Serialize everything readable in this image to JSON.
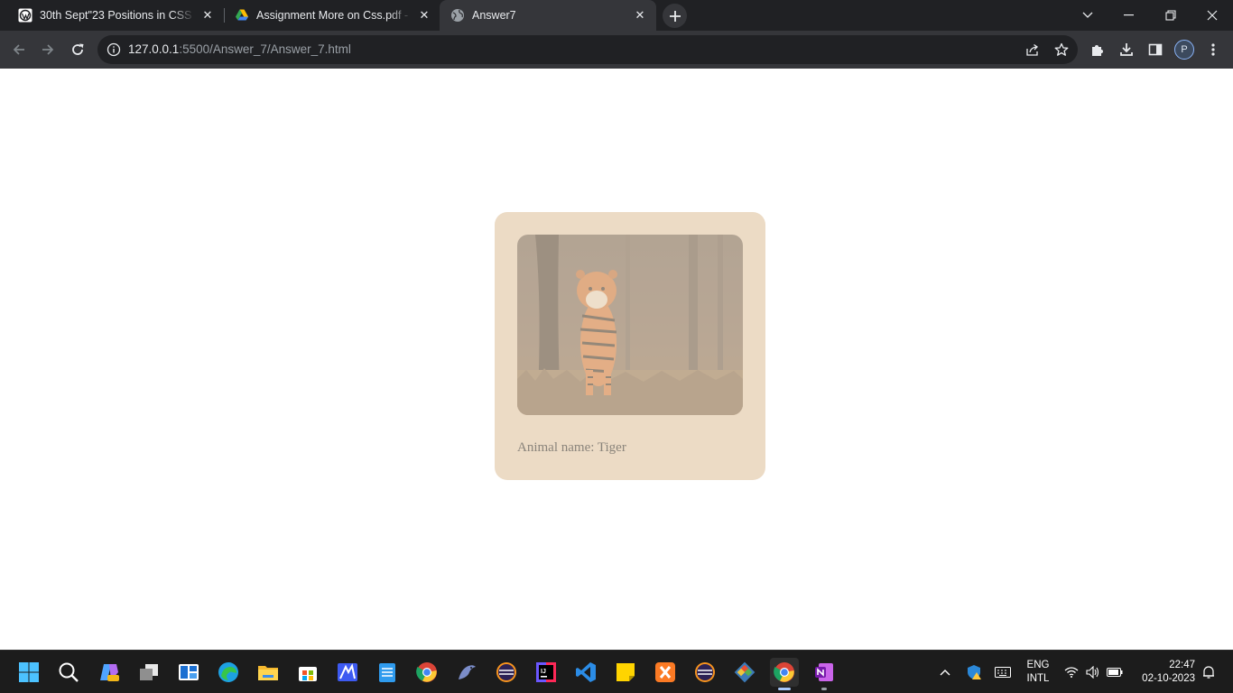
{
  "browser": {
    "tabs": [
      {
        "title": "30th Sept\"23 Positions in CSS - P",
        "icon": "wordpress-like-icon"
      },
      {
        "title": "Assignment More on Css.pdf - G",
        "icon": "google-drive-icon"
      },
      {
        "title": "Answer7",
        "icon": "globe-icon"
      }
    ],
    "url_host": "127.0.0.1",
    "url_path": ":5500/Answer_7/Answer_7.html",
    "profile_initial": "P"
  },
  "page": {
    "card_background": "#ecdbc5",
    "image_subject": "Tiger",
    "caption": "Animal name: Tiger"
  },
  "taskbar": {
    "apps": [
      "start-icon",
      "search-icon",
      "copilot-icon",
      "task-view-icon",
      "widgets-icon",
      "edge-icon",
      "file-explorer-icon",
      "store-icon",
      "power-automate-icon",
      "notepad-icon",
      "chrome-icon",
      "mysql-workbench-icon",
      "eclipse-icon",
      "intellij-icon",
      "vscode-icon",
      "sticky-notes-icon",
      "xampp-icon",
      "eclipse-alt-icon",
      "git-icon",
      "chrome-active-icon",
      "onenote-icon"
    ],
    "language": "ENG",
    "layout": "INTL",
    "time": "22:47",
    "date": "02-10-2023"
  }
}
